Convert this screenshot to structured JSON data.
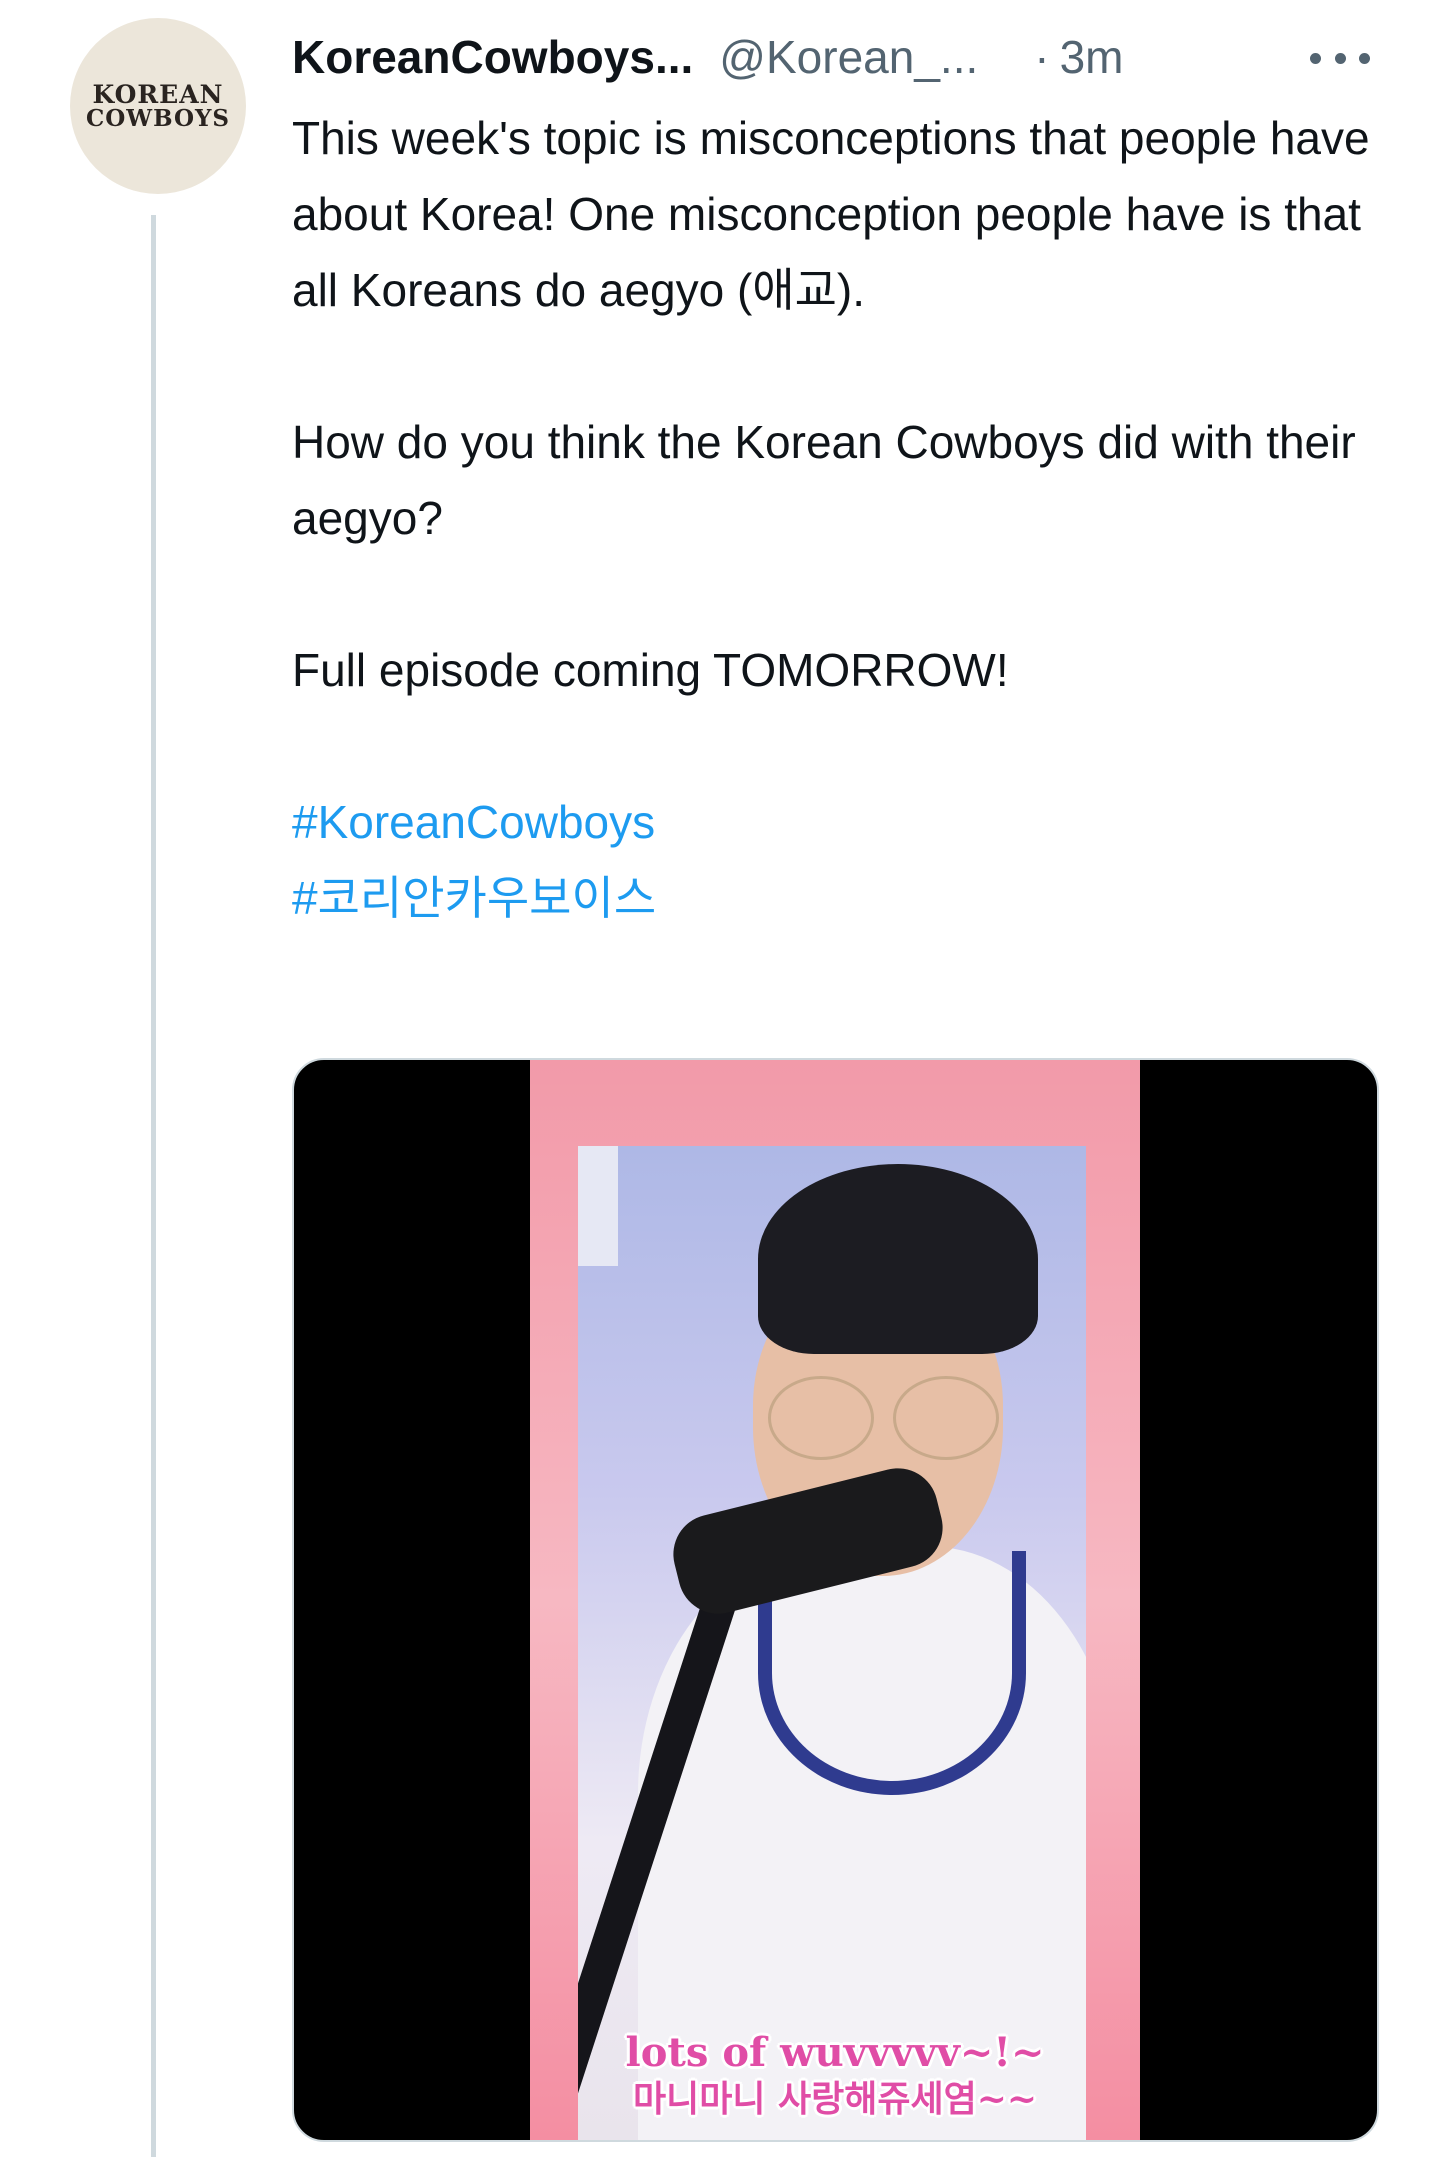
{
  "author": {
    "avatar_line1": "KOREAN",
    "avatar_line2": "COWBOYS",
    "display_name": "KoreanCowboys...",
    "handle": "@Korean_...",
    "separator": "·",
    "timestamp": "3m"
  },
  "tweet": {
    "paragraphs": [
      "This week's topic is misconceptions that people have about Korea! One misconception people have is that all Koreans do aegyo (애교).",
      "How do you think the Korean Cowboys did with their aegyo?",
      "Full episode coming TOMORROW!"
    ],
    "hashtags": [
      "#KoreanCowboys",
      "#코리안카우보이스"
    ]
  },
  "media": {
    "caption_line1": "lots of wuvvvvv~!~",
    "caption_line2": "마니마니 사랑해쥬세염~~"
  },
  "colors": {
    "link": "#1d9bf0",
    "secondary_text": "#536471",
    "thread_line": "#cfd9de"
  }
}
